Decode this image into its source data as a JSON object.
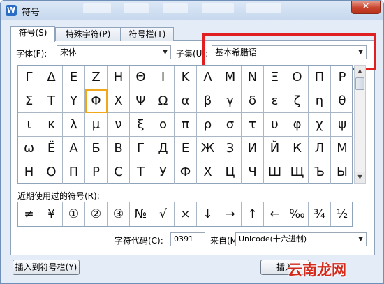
{
  "window": {
    "title": "符号",
    "app_icon": "W",
    "close_label": "✕"
  },
  "tabs": [
    {
      "label": "符号(S)"
    },
    {
      "label": "特殊字符(P)"
    },
    {
      "label": "符号栏(T)"
    }
  ],
  "font": {
    "label": "字体(F):",
    "value": "宋体"
  },
  "subset": {
    "label": "子集(U):",
    "value": "基本希腊语"
  },
  "symbols": [
    [
      "Γ",
      "Δ",
      "Ε",
      "Ζ",
      "Η",
      "Θ",
      "Ι",
      "Κ",
      "Λ",
      "Μ",
      "Ν",
      "Ξ",
      "Ο",
      "Π",
      "Ρ"
    ],
    [
      "Σ",
      "Τ",
      "Υ",
      "Φ",
      "Χ",
      "Ψ",
      "Ω",
      "α",
      "β",
      "γ",
      "δ",
      "ε",
      "ζ",
      "η",
      "θ"
    ],
    [
      "ι",
      "κ",
      "λ",
      "μ",
      "ν",
      "ξ",
      "ο",
      "π",
      "ρ",
      "σ",
      "τ",
      "υ",
      "φ",
      "χ",
      "ψ"
    ],
    [
      "ω",
      "Ё",
      "А",
      "Б",
      "В",
      "Г",
      "Д",
      "Е",
      "Ж",
      "З",
      "И",
      "Й",
      "К",
      "Л",
      "М"
    ],
    [
      "Н",
      "О",
      "П",
      "Р",
      "С",
      "Т",
      "У",
      "Ф",
      "Х",
      "Ц",
      "Ч",
      "Ш",
      "Щ",
      "Ъ",
      "Ы"
    ]
  ],
  "selected_symbol": "Φ",
  "recent": {
    "label": "近期使用过的符号(R):",
    "items": [
      "≠",
      "¥",
      "①",
      "②",
      "③",
      "№",
      "√",
      "×",
      "↓",
      "→",
      "↑",
      "←",
      "‰",
      "¾",
      "½"
    ]
  },
  "char_code": {
    "label": "字符代码(C):",
    "value": "0391"
  },
  "from": {
    "label": "来自(M)",
    "value": "Unicode(十六进制)"
  },
  "buttons": {
    "insert_to_bar": "插入到符号栏(Y)",
    "insert": "插入"
  },
  "watermark": "云南龙网",
  "colors": {
    "highlight": "#e02020",
    "selection": "#f0a81a",
    "close": "#c9452d"
  }
}
